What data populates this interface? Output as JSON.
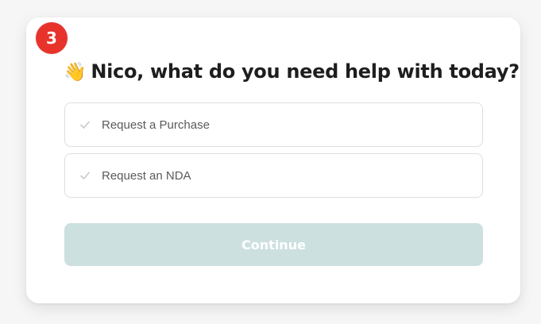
{
  "step": {
    "number": "3",
    "color": "#e8332b"
  },
  "header": {
    "emoji": "👋",
    "title": "Nico, what do you need help with today?"
  },
  "options": [
    {
      "label": "Request a Purchase",
      "icon": "check-icon"
    },
    {
      "label": "Request an NDA",
      "icon": "check-icon"
    }
  ],
  "actions": {
    "continue_label": "Continue",
    "continue_color": "#cde0e0"
  }
}
